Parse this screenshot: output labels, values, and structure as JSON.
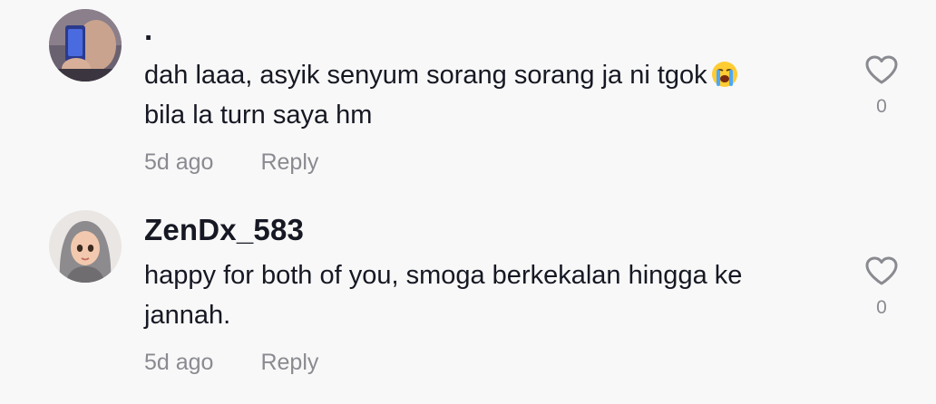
{
  "comments": [
    {
      "username": ".",
      "text_lines": [
        "dah laaa, asyik senyum sorang sorang ja ni tgok",
        "bila la turn saya hm"
      ],
      "emoji": "loudly-crying-face-emoji",
      "time": "5d ago",
      "reply_label": "Reply",
      "like_count": "0",
      "like_icon": "heart-outline-icon"
    },
    {
      "username": "ZenDx_583",
      "text_lines": [
        "happy for both of you, smoga berkekalan hingga ke",
        "jannah."
      ],
      "time": "5d ago",
      "reply_label": "Reply",
      "like_count": "0",
      "like_icon": "heart-outline-icon"
    }
  ],
  "colors": {
    "background": "#f8f8f8",
    "text": "#161823",
    "muted": "#8a8b91"
  }
}
